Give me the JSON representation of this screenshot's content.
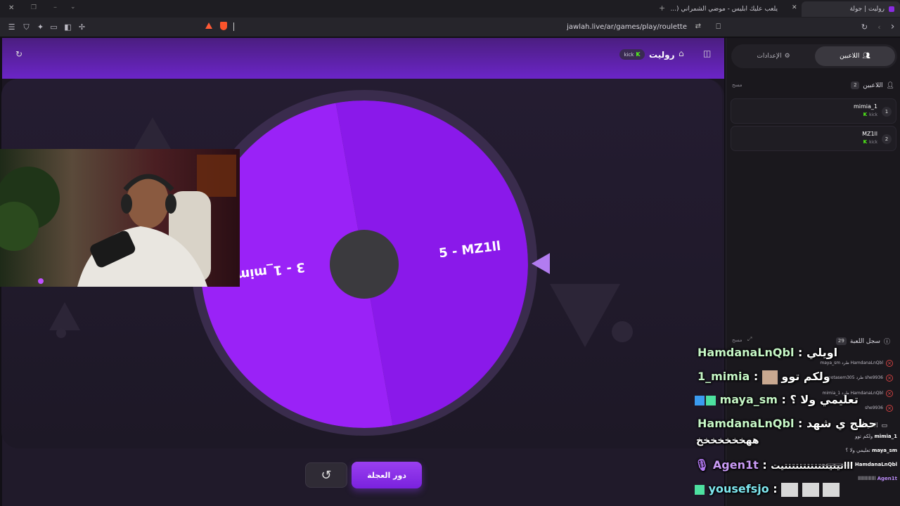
{
  "browser": {
    "tabs": [
      {
        "title": "روليت | جولة",
        "active": true
      },
      {
        "title": "يلعب عليك ابليس - موضي الشمراني (...",
        "active": false
      }
    ],
    "url": "jawlah.live/ar/games/play/roulette"
  },
  "game": {
    "title": "روليت",
    "kick_label": "kick",
    "wheel_segments": [
      {
        "label": "5 - MZ1ll",
        "color": "#8a19ea"
      },
      {
        "label": "3 - 1_mimia",
        "color": "#9a22f7"
      }
    ],
    "spin_label": "دور العجلة",
    "colors": {
      "accent": "#8a2be2",
      "header_start": "#4b1e80",
      "header_end": "#6b25c7"
    }
  },
  "sidebar": {
    "tabs": {
      "players": "اللاعبين",
      "settings": "الإعدادات"
    },
    "players_section": {
      "title": "اللاعبين",
      "count": "2",
      "clear": "مسح"
    },
    "players": [
      {
        "rank": "1",
        "name": "mimia_1",
        "source": "kick"
      },
      {
        "rank": "2",
        "name": "MZ1ll",
        "source": "kick"
      }
    ],
    "log_section": {
      "title": "سجل اللعبة",
      "count": "29",
      "clear": "مسح"
    },
    "log": [
      "HamdanaLnQbl طرد maya_sm",
      "she9936 طرد motasem305",
      "HamdanaLnQbl طرد mimia_1",
      "she9936"
    ],
    "chat_section": {
      "title": "الدردشة"
    },
    "mini_chat": [
      {
        "user": "mimia_1",
        "text": "ولكم توو"
      },
      {
        "user": "maya_sm",
        "text": "تعليمي ولا ؟"
      },
      {
        "user": "HamdanaLnQbl",
        "text": "ااتيتيتتتتتتتتتتتتيت"
      },
      {
        "user": "Agen1t",
        "text": "ااااااااااااا"
      }
    ]
  },
  "chat_overlay": [
    {
      "user": "HamdanaLnQbl",
      "text": "اويلي",
      "color": "#c6f7c6"
    },
    {
      "user": "1_mimia",
      "text": "ولكم توو",
      "color": "#c6f7c6"
    },
    {
      "user": "maya_sm",
      "text": "تعليمي ولا ؟",
      "color": "#c6f7c6"
    },
    {
      "user": "HamdanaLnQbl",
      "text": "حظج ي شهد",
      "color": "#c6f7c6"
    },
    {
      "user": "",
      "text": "ههخخخخخخخ",
      "color": "#ffffff"
    },
    {
      "user": "Agen1t",
      "text": "اااتيتيتتتتتتتتتتتتيت",
      "color": "#c99af5"
    },
    {
      "user": "yousefsjo",
      "text": "",
      "color": "#7fe8f0"
    }
  ]
}
